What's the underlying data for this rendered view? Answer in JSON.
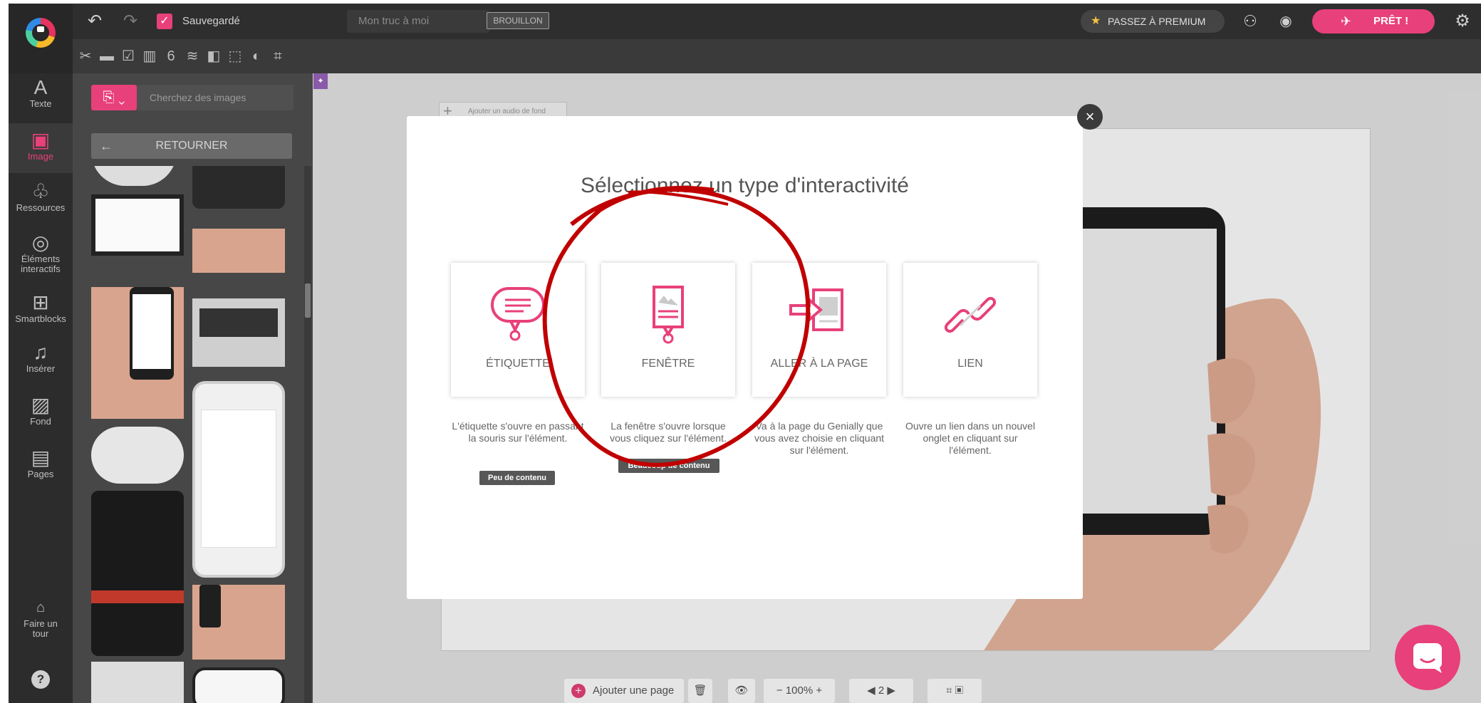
{
  "topbar": {
    "saved_label": "Sauvegardé",
    "title_placeholder": "Mon truc à moi",
    "status_badge": "BROUILLON",
    "premium_label": "PASSEZ À PREMIUM",
    "ready_label": "PRÊT !"
  },
  "sidebar": {
    "items": [
      {
        "label": "Texte",
        "icon": "text-icon"
      },
      {
        "label": "Image",
        "icon": "image-icon"
      },
      {
        "label": "Ressources",
        "icon": "resources-icon"
      },
      {
        "label": "Éléments interactifs",
        "icon": "interactive-icon"
      },
      {
        "label": "Smartblocks",
        "icon": "smartblocks-icon"
      },
      {
        "label": "Insérer",
        "icon": "insert-icon"
      },
      {
        "label": "Fond",
        "icon": "background-icon"
      },
      {
        "label": "Pages",
        "icon": "pages-icon"
      },
      {
        "label": "Faire un tour",
        "icon": "tour-icon"
      }
    ],
    "help": "?"
  },
  "panel": {
    "search_placeholder": "Cherchez des images",
    "back_label": "RETOURNER"
  },
  "canvas": {
    "bg_audio_label": "Ajouter un audio de fond"
  },
  "bottom": {
    "add_page_label": "Ajouter une page",
    "zoom": "100%",
    "page_number": "2"
  },
  "modal": {
    "title": "Sélectionnez un type d'interactivité",
    "options": [
      {
        "label": "ÉTIQUETTE",
        "desc": "L'étiquette s'ouvre en passant la souris sur l'élément.",
        "tag": "Peu de contenu"
      },
      {
        "label": "FENÊTRE",
        "desc": "La fenêtre s'ouvre lorsque vous cliquez sur l'élément.",
        "tag": "Beaucoup de contenu"
      },
      {
        "label": "ALLER À LA PAGE",
        "desc": "Va à la page du Genially que vous avez choisie en cliquant sur l'élément.",
        "tag": ""
      },
      {
        "label": "LIEN",
        "desc": "Ouvre un lien dans un nouvel onglet en cliquant sur l'élément.",
        "tag": ""
      }
    ],
    "close": "×"
  },
  "colors": {
    "accent": "#e8407a",
    "annotation": "#c00000",
    "dark_bar": "#2e2e2e"
  }
}
